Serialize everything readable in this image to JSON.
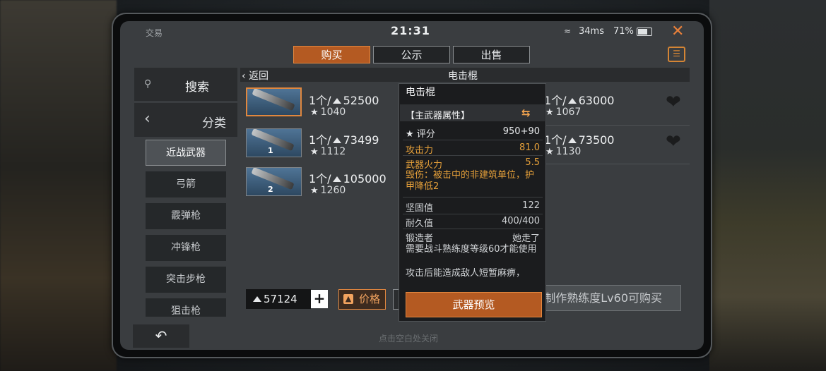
{
  "status": {
    "app_label": "交易",
    "time": "21:31",
    "ping": "34ms",
    "battery": "71%"
  },
  "tabs": [
    {
      "label": "购买",
      "active": true
    },
    {
      "label": "公示",
      "active": false
    },
    {
      "label": "出售",
      "active": false
    }
  ],
  "sidebar": {
    "search": "搜索",
    "category": "分类",
    "categories": [
      "近战武器",
      "弓箭",
      "霰弹枪",
      "冲锋枪",
      "突击步枪",
      "狙击枪"
    ]
  },
  "breadcrumb": {
    "back": "返回",
    "title": "电击棍"
  },
  "listings": [
    {
      "qty": "1个/",
      "price": "52500",
      "score": "1040",
      "level": ""
    },
    {
      "qty": "1个/",
      "price": "63000",
      "score": "1067",
      "level": ""
    },
    {
      "qty": "1个/",
      "price": "73499",
      "score": "1112",
      "level": "1"
    },
    {
      "qty": "1个/",
      "price": "73500",
      "score": "1130",
      "level": ""
    },
    {
      "qty": "1个/",
      "price": "105000",
      "score": "1260",
      "level": "2"
    }
  ],
  "footer": {
    "funds": "57124",
    "price_sort": "价格",
    "buy_requirement": "制作熟练度Lv60可购买",
    "close_hint": "点击空白处关闭"
  },
  "tooltip": {
    "title": "电击棍",
    "section": "【主武器属性】",
    "score_label": "评分",
    "score_value": "950+90",
    "attack_label": "攻击力",
    "attack_value": "81.0",
    "fire_label": "武器火力",
    "fire_value": "5.5",
    "damage_text": "毁伤：被击中的非建筑单位，护甲降低2",
    "hardness_label": "坚固值",
    "hardness_value": "122",
    "durability_label": "耐久值",
    "durability_value": "400/400",
    "forger_label": "锻造者",
    "forger_value": "她走了",
    "requirement": "需要战斗熟练度等级60才能使用",
    "effect": "攻击后能造成敌人短暂麻痹，",
    "preview_button": "武器预览"
  },
  "colors": {
    "accent": "#b45a22",
    "accent_border": "#e2873f",
    "highlight_text": "#e7a13a"
  }
}
